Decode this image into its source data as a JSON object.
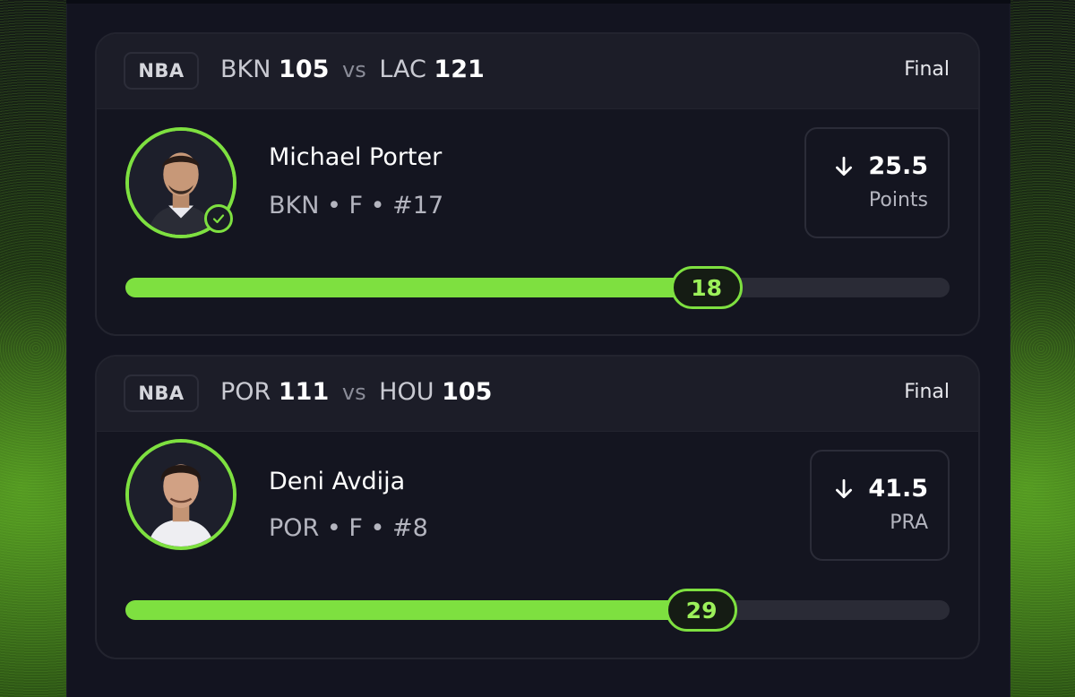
{
  "colors": {
    "accent": "#7ee040",
    "card_bg": "#141520",
    "header_bg": "#1c1d28"
  },
  "picks": [
    {
      "league": "NBA",
      "matchup": {
        "team_a": "BKN",
        "score_a": "105",
        "vs": "vs",
        "team_b": "LAC",
        "score_b": "121"
      },
      "status": "Final",
      "player": {
        "name": "Michael Porter",
        "meta": "BKN • F • #17",
        "avatar_icon": "player-headshot",
        "verified": true
      },
      "line": {
        "direction_icon": "arrow-down-icon",
        "value": "25.5",
        "stat": "Points"
      },
      "progress": {
        "actual": "18",
        "fraction": 0.705
      }
    },
    {
      "league": "NBA",
      "matchup": {
        "team_a": "POR",
        "score_a": "111",
        "vs": "vs",
        "team_b": "HOU",
        "score_b": "105"
      },
      "status": "Final",
      "player": {
        "name": "Deni Avdija",
        "meta": "POR • F • #8",
        "avatar_icon": "player-headshot",
        "verified": false
      },
      "line": {
        "direction_icon": "arrow-down-icon",
        "value": "41.5",
        "stat": "PRA"
      },
      "progress": {
        "actual": "29",
        "fraction": 0.699
      }
    }
  ]
}
